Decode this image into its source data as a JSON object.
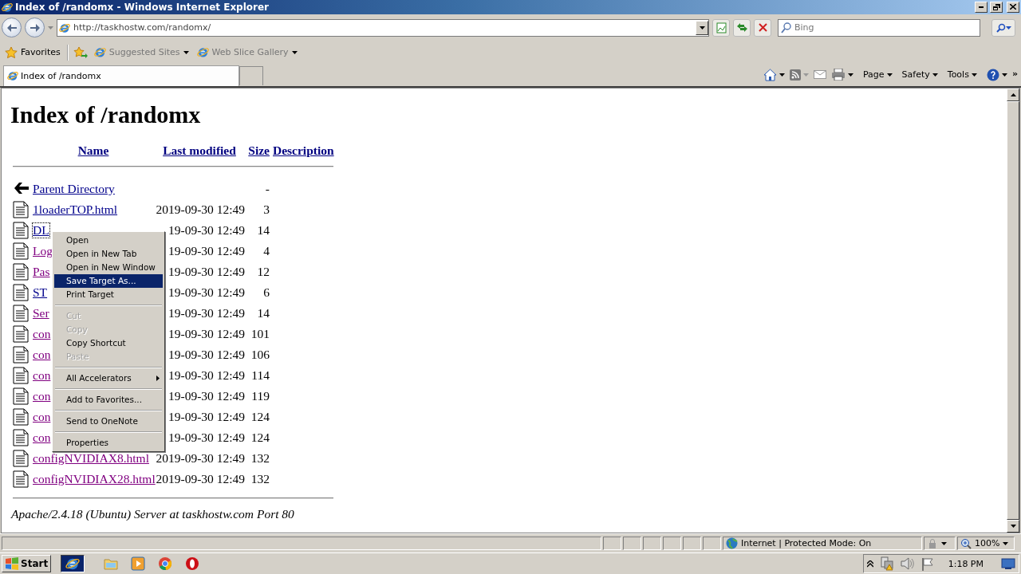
{
  "window": {
    "title": "Index of /randomx - Windows Internet Explorer"
  },
  "address_bar": {
    "url": "http://taskhostw.com/randomx/"
  },
  "search": {
    "placeholder": "Bing"
  },
  "favorites_bar": {
    "favorites": "Favorites",
    "links": [
      "Suggested Sites",
      "Web Slice Gallery"
    ]
  },
  "tabs": [
    {
      "label": "Index of /randomx",
      "selected": true
    }
  ],
  "command_bar": {
    "menus": [
      "Page",
      "Safety",
      "Tools"
    ],
    "overflow": "»"
  },
  "page": {
    "heading": "Index of /randomx",
    "columns": [
      "Name",
      "Last modified",
      "Size",
      "Description"
    ],
    "rows": [
      {
        "kind": "parent",
        "name": "Parent Directory",
        "size": "-",
        "visited": false,
        "focused": false
      },
      {
        "kind": "file",
        "name": "1loaderTOP.html",
        "date": "2019-09-30 12:49",
        "size": "3",
        "visited": false,
        "focused": false
      },
      {
        "kind": "file",
        "name": "DL",
        "date": "19-09-30 12:49",
        "size": "14",
        "visited": false,
        "focused": true
      },
      {
        "kind": "file",
        "name": "Log",
        "date": "19-09-30 12:49",
        "size": "4",
        "visited": true,
        "focused": false
      },
      {
        "kind": "file",
        "name": "Pas",
        "date": "19-09-30 12:49",
        "size": "12",
        "visited": true,
        "focused": false
      },
      {
        "kind": "file",
        "name": "ST",
        "date": "19-09-30 12:49",
        "size": "6",
        "visited": false,
        "focused": false
      },
      {
        "kind": "file",
        "name": "Ser",
        "date": "19-09-30 12:49",
        "size": "14",
        "visited": true,
        "focused": false
      },
      {
        "kind": "file",
        "name": "con",
        "date": "19-09-30 12:49",
        "size": "101",
        "visited": true,
        "focused": false
      },
      {
        "kind": "file",
        "name": "con",
        "date": "19-09-30 12:49",
        "size": "106",
        "visited": true,
        "focused": false
      },
      {
        "kind": "file",
        "name": "con",
        "date": "19-09-30 12:49",
        "size": "114",
        "visited": true,
        "focused": false
      },
      {
        "kind": "file",
        "name": "con",
        "date": "19-09-30 12:49",
        "size": "119",
        "visited": true,
        "focused": false
      },
      {
        "kind": "file",
        "name": "con",
        "date": "19-09-30 12:49",
        "size": "124",
        "visited": true,
        "focused": false
      },
      {
        "kind": "file",
        "name": "con",
        "date": "19-09-30 12:49",
        "size": "124",
        "visited": true,
        "focused": false
      },
      {
        "kind": "file",
        "name": "configNVIDIAX8.html",
        "date": "2019-09-30 12:49",
        "size": "132",
        "visited": true,
        "focused": false
      },
      {
        "kind": "file",
        "name": "configNVIDIAX28.html",
        "date": "2019-09-30 12:49",
        "size": "132",
        "visited": true,
        "focused": false
      }
    ],
    "footer": "Apache/2.4.18 (Ubuntu) Server at taskhostw.com Port 80"
  },
  "context_menu": {
    "items": [
      {
        "kind": "item",
        "label": "Open",
        "disabled": false,
        "selected": false,
        "submenu": false
      },
      {
        "kind": "item",
        "label": "Open in New Tab",
        "disabled": false,
        "selected": false,
        "submenu": false
      },
      {
        "kind": "item",
        "label": "Open in New Window",
        "disabled": false,
        "selected": false,
        "submenu": false
      },
      {
        "kind": "item",
        "label": "Save Target As...",
        "disabled": false,
        "selected": true,
        "submenu": false
      },
      {
        "kind": "item",
        "label": "Print Target",
        "disabled": false,
        "selected": false,
        "submenu": false
      },
      {
        "kind": "separator"
      },
      {
        "kind": "item",
        "label": "Cut",
        "disabled": true,
        "selected": false,
        "submenu": false
      },
      {
        "kind": "item",
        "label": "Copy",
        "disabled": true,
        "selected": false,
        "submenu": false
      },
      {
        "kind": "item",
        "label": "Copy Shortcut",
        "disabled": false,
        "selected": false,
        "submenu": false
      },
      {
        "kind": "item",
        "label": "Paste",
        "disabled": true,
        "selected": false,
        "submenu": false
      },
      {
        "kind": "separator"
      },
      {
        "kind": "item",
        "label": "All Accelerators",
        "disabled": false,
        "selected": false,
        "submenu": true
      },
      {
        "kind": "separator"
      },
      {
        "kind": "item",
        "label": "Add to Favorites...",
        "disabled": false,
        "selected": false,
        "submenu": false
      },
      {
        "kind": "separator"
      },
      {
        "kind": "item",
        "label": "Send to OneNote",
        "disabled": false,
        "selected": false,
        "submenu": false
      },
      {
        "kind": "separator"
      },
      {
        "kind": "item",
        "label": "Properties",
        "disabled": false,
        "selected": false,
        "submenu": false
      }
    ]
  },
  "status_bar": {
    "zone": "Internet | Protected Mode: On",
    "zoom": "100%"
  },
  "taskbar": {
    "start": "Start",
    "clock": "1:18 PM"
  }
}
